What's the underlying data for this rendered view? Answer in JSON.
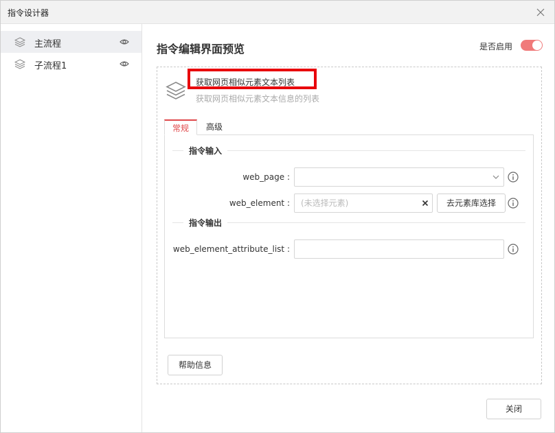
{
  "window": {
    "title": "指令设计器"
  },
  "sidebar": {
    "items": [
      {
        "label": "主流程",
        "active": true
      },
      {
        "label": "子流程1",
        "active": false
      }
    ]
  },
  "main": {
    "title": "指令编辑界面预览",
    "toggle_label": "是否启用",
    "toggle_on": true
  },
  "command": {
    "name": "获取网页相似元素文本列表",
    "description": "获取网页相似元素文本信息的列表"
  },
  "tabs": [
    {
      "label": "常规",
      "active": true
    },
    {
      "label": "高级",
      "active": false
    }
  ],
  "sections": {
    "input": "指令输入",
    "output": "指令输出"
  },
  "fields": {
    "web_page": {
      "label": "web_page :",
      "value": ""
    },
    "web_element": {
      "label": "web_element :",
      "placeholder": "(未选择元素)"
    },
    "attr_list": {
      "label": "web_element_attribute_list :",
      "value": ""
    }
  },
  "buttons": {
    "element_library": "去元素库选择",
    "help": "帮助信息",
    "close": "关闭"
  },
  "colors": {
    "accent": "#e0484a",
    "toggle": "#f07a7a",
    "highlight": "#e8000b"
  }
}
